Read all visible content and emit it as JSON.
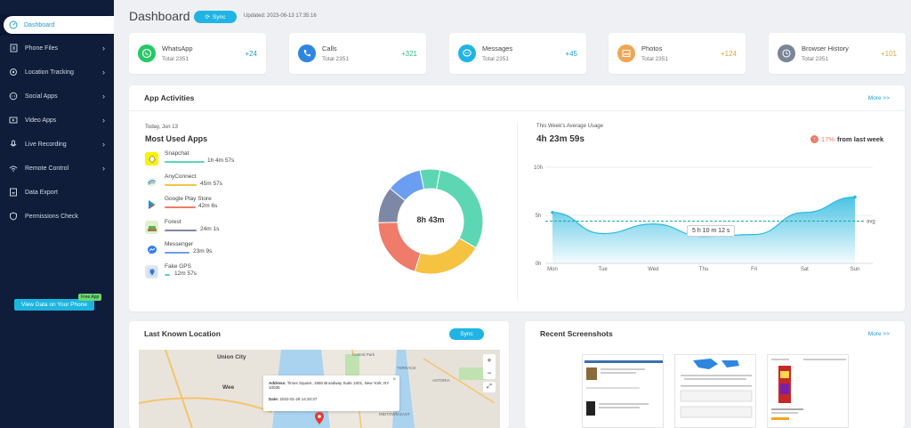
{
  "sidebar": {
    "items": [
      {
        "label": "Dashboard",
        "icon": "gauge-icon"
      },
      {
        "label": "Phone Files",
        "icon": "file-icon"
      },
      {
        "label": "Location Tracking",
        "icon": "location-icon"
      },
      {
        "label": "Social Apps",
        "icon": "chat-icon"
      },
      {
        "label": "Video Apps",
        "icon": "video-icon"
      },
      {
        "label": "Live Recording",
        "icon": "recording-icon"
      },
      {
        "label": "Remote Control",
        "icon": "remote-icon"
      },
      {
        "label": "Data Export",
        "icon": "export-icon"
      },
      {
        "label": "Permissions Check",
        "icon": "shield-icon"
      }
    ],
    "cta_label": "View Data on Your Phone",
    "cta_badge": "Free App"
  },
  "header": {
    "title": "Dashboard",
    "sync_label": "Sync",
    "updated": "Updated: 2023-06-13 17:35:16"
  },
  "stats": [
    {
      "name": "WhatsApp",
      "total": "Total 2351",
      "delta": "+24",
      "color": "#25c864",
      "delta_color": "#1e9bd7",
      "icon": "whatsapp-icon"
    },
    {
      "name": "Calls",
      "total": "Total 2351",
      "delta": "+321",
      "color": "#2e86de",
      "delta_color": "#2ebf8b",
      "icon": "phone-icon"
    },
    {
      "name": "Messages",
      "total": "Total 2351",
      "delta": "+45",
      "color": "#20b4e4",
      "delta_color": "#1e9bd7",
      "icon": "message-icon"
    },
    {
      "name": "Photos",
      "total": "Total 2351",
      "delta": "+124",
      "color": "#f0a555",
      "delta_color": "#e0a13a",
      "icon": "photo-icon"
    },
    {
      "name": "Browser History",
      "total": "Total 2351",
      "delta": "+101",
      "color": "#7a8596",
      "delta_color": "#c9a94a",
      "icon": "history-icon"
    }
  ],
  "activities": {
    "title": "App Activities",
    "more": "More >>",
    "date": "Today, Jun 13",
    "most_used_title": "Most Used Apps",
    "apps": [
      {
        "name": "Snapchat",
        "duration": "1h 4m 57s",
        "bar_color": "#5dd6b4",
        "icon": "snapchat-icon",
        "icon_bg": "#fff200",
        "minutes": 64.95
      },
      {
        "name": "AnyConnect",
        "duration": "45m 57s",
        "bar_color": "#f5c242",
        "icon": "anyconnect-icon",
        "icon_bg": "#ffffff",
        "minutes": 45.95
      },
      {
        "name": "Google Play Store",
        "duration": "42m 6s",
        "bar_color": "#ef7b6a",
        "icon": "play-store-icon",
        "icon_bg": "#ffffff",
        "minutes": 42.1
      },
      {
        "name": "Forest",
        "duration": "24m 1s",
        "bar_color": "#7d88a6",
        "icon": "forest-icon",
        "icon_bg": "#dff2d0",
        "minutes": 24.02
      },
      {
        "name": "Messenger",
        "duration": "23m 9s",
        "bar_color": "#6b9ef0",
        "icon": "messenger-icon",
        "icon_bg": "#ffffff",
        "minutes": 23.15
      },
      {
        "name": "Fake GPS",
        "duration": "12m 57s",
        "bar_color": "#5dd6b4",
        "icon": "fake-gps-icon",
        "icon_bg": "#ffffff",
        "minutes": 12.95
      }
    ],
    "donut_center": "8h 43m",
    "weekly_title": "This Week's Average Usage",
    "weekly_value": "4h 23m 59s",
    "trend_pct": "17%",
    "trend_text": "from last week",
    "tooltip": "5 h 10 m 12 s",
    "avg_label": "avg"
  },
  "chart_data": {
    "type": "area",
    "categories": [
      "Mon",
      "Tue",
      "Wed",
      "Thu",
      "Fri",
      "Sat",
      "Sun"
    ],
    "values": [
      5.3,
      3.1,
      4.1,
      2.8,
      3.0,
      5.3,
      6.9
    ],
    "avg": 4.4,
    "ylim": [
      0,
      10
    ],
    "yticks": [
      "10h",
      "5h",
      "0h"
    ],
    "color": "#2cb9e0"
  },
  "location": {
    "title": "Last Known Location",
    "sync_label": "Sync",
    "address_label": "Address:",
    "address": "Times Square, 1560 Broadway Suite 1001, New York, NY 10036",
    "date_label": "Date:",
    "date": "2022-01-28 14:20:37",
    "map_labels": [
      "Union City",
      "Wee",
      "TERRACE",
      "ASTORIA",
      "MIDTOWN EAST",
      "Central Park"
    ],
    "zoom_in": "+",
    "zoom_out": "−"
  },
  "screenshots": {
    "title": "Recent Screenshots",
    "more": "More >>"
  }
}
